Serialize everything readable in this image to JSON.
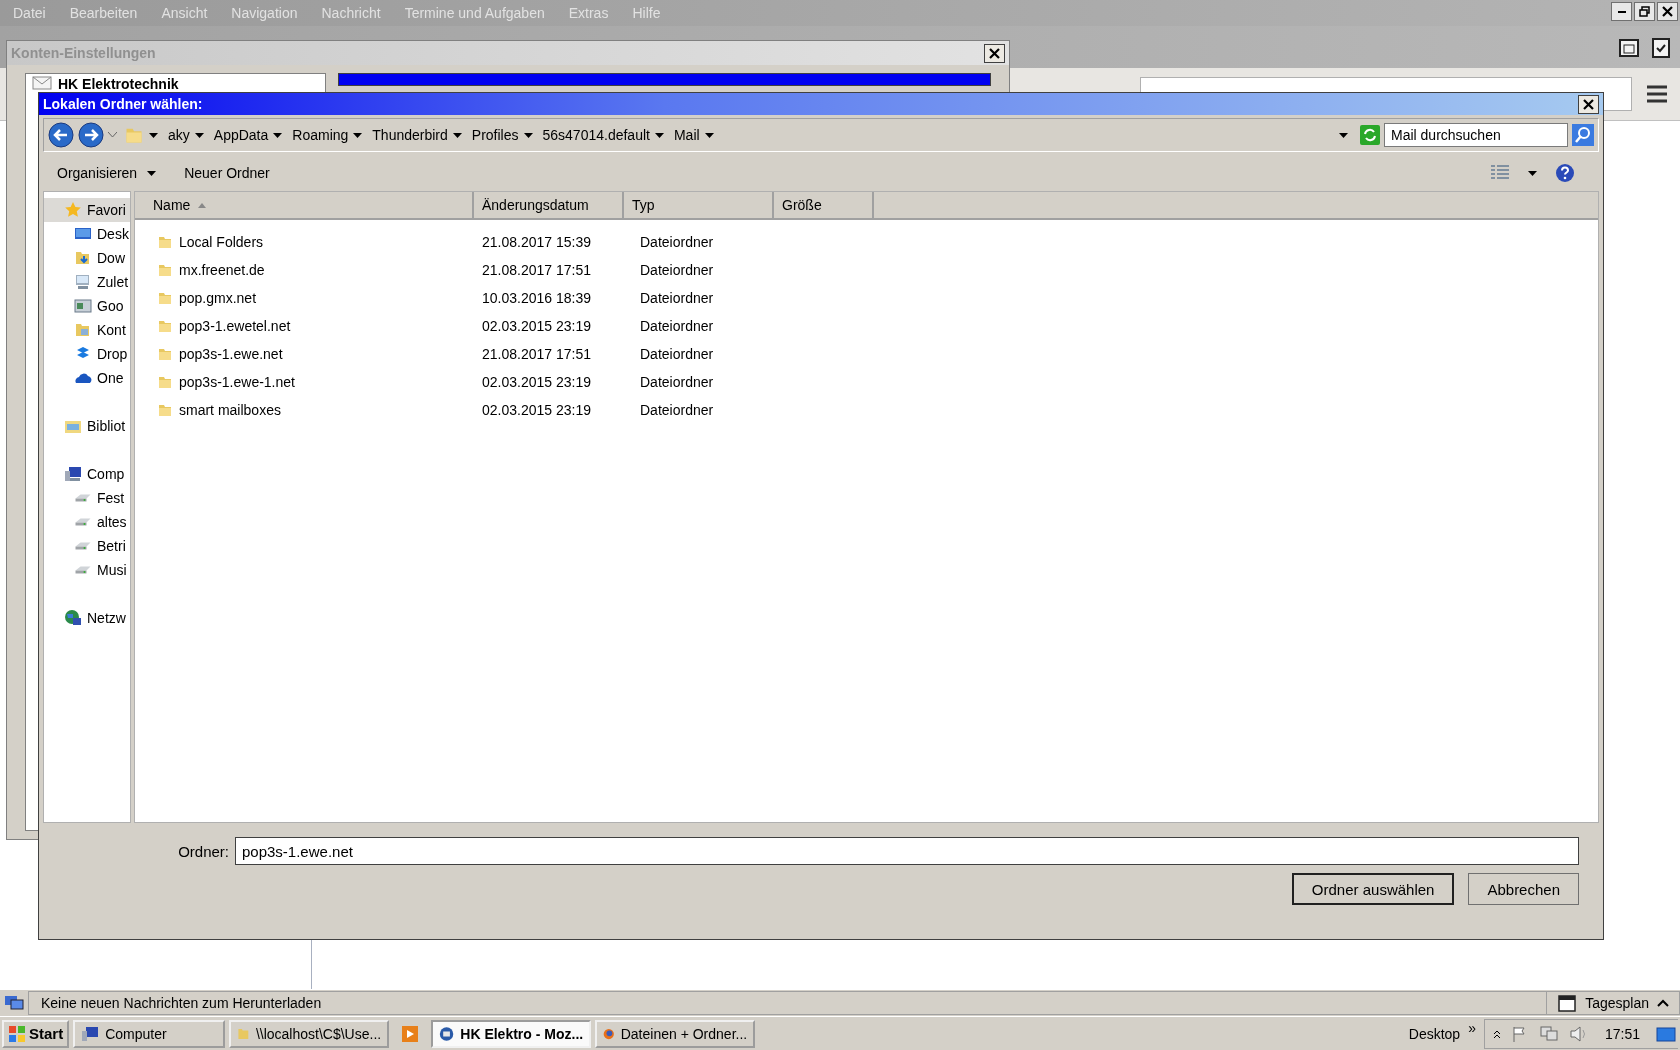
{
  "app_menu": [
    {
      "label": "Datei",
      "disabled": true
    },
    {
      "label": "Bearbeiten",
      "disabled": true
    },
    {
      "label": "Ansicht",
      "disabled": true
    },
    {
      "label": "Navigation",
      "disabled": true
    },
    {
      "label": "Nachricht",
      "disabled": true
    },
    {
      "label": "Termine und Aufgaben",
      "disabled": true
    },
    {
      "label": "Extras",
      "disabled": true
    },
    {
      "label": "Hilfe",
      "disabled": true
    }
  ],
  "account_settings": {
    "title": "Konten-Einstellungen",
    "account": "HK Elektrotechnik"
  },
  "dialog": {
    "title": "Lokalen Ordner wählen:",
    "breadcrumb": [
      "aky",
      "AppData",
      "Roaming",
      "Thunderbird",
      "Profiles",
      "56s47014.default",
      "Mail"
    ],
    "search": {
      "placeholder": "Mail durchsuchen"
    },
    "commands": [
      {
        "label": "Organisieren",
        "kind": "menu"
      },
      {
        "label": "Neuer Ordner",
        "kind": "button"
      }
    ],
    "nav": [
      {
        "label": "Favori",
        "selected": true,
        "children": [
          {
            "label": "Desk",
            "selected": false
          },
          {
            "label": "Dow",
            "selected": false
          },
          {
            "label": "Zulet",
            "selected": false
          },
          {
            "label": "Goo",
            "selected": false
          },
          {
            "label": "Kont",
            "selected": false
          },
          {
            "label": "Drop",
            "selected": false
          },
          {
            "label": "One",
            "selected": false
          }
        ]
      },
      {
        "label": "Bibliot",
        "selected": false
      },
      {
        "label": "Comp",
        "selected": false,
        "children": [
          {
            "label": "Fest",
            "selected": false
          },
          {
            "label": "altes",
            "selected": false
          },
          {
            "label": "Betri",
            "selected": false
          },
          {
            "label": "Musi",
            "selected": false
          }
        ]
      },
      {
        "label": "Netzw",
        "selected": false
      }
    ],
    "columns": [
      {
        "label": "Name",
        "sorted": true
      },
      {
        "label": "Änderungsdatum",
        "sorted": false
      },
      {
        "label": "Typ",
        "sorted": false
      },
      {
        "label": "Größe",
        "sorted": false
      }
    ],
    "rows": [
      {
        "name": "Local Folders",
        "date": "21.08.2017 15:39",
        "type": "Dateiordner"
      },
      {
        "name": "mx.freenet.de",
        "date": "21.08.2017 17:51",
        "type": "Dateiordner"
      },
      {
        "name": "pop.gmx.net",
        "date": "10.03.2016 18:39",
        "type": "Dateiordner"
      },
      {
        "name": "pop3-1.ewetel.net",
        "date": "02.03.2015 23:19",
        "type": "Dateiordner"
      },
      {
        "name": "pop3s-1.ewe.net",
        "date": "21.08.2017 17:51",
        "type": "Dateiordner"
      },
      {
        "name": "pop3s-1.ewe-1.net",
        "date": "02.03.2015 23:19",
        "type": "Dateiordner"
      },
      {
        "name": "smart mailboxes",
        "date": "02.03.2015 23:19",
        "type": "Dateiordner"
      }
    ],
    "folder_label": "Ordner:",
    "folder_value": "pop3s-1.ewe.net",
    "buttons": [
      {
        "label": "Ordner auswählen",
        "default": true
      },
      {
        "label": "Abbrechen",
        "default": false
      }
    ]
  },
  "status_bar": {
    "text": "Keine neuen Nachrichten zum Herunterladen",
    "today_pane": "Tagesplan"
  },
  "taskbar": {
    "start": "Start",
    "tasks": [
      {
        "label": "Computer",
        "active": false,
        "kind": "computer"
      },
      {
        "label": "\\\\localhost\\C$\\Use...",
        "active": false,
        "kind": "folder"
      },
      {
        "active": false,
        "kind": "media"
      },
      {
        "label": "HK Elektro - Moz...",
        "active": true,
        "kind": "mail"
      },
      {
        "label": "Dateinen + Ordner...",
        "active": false,
        "kind": "browser"
      }
    ],
    "desktop": "Desktop",
    "expand": "»",
    "clock": "17:51"
  }
}
